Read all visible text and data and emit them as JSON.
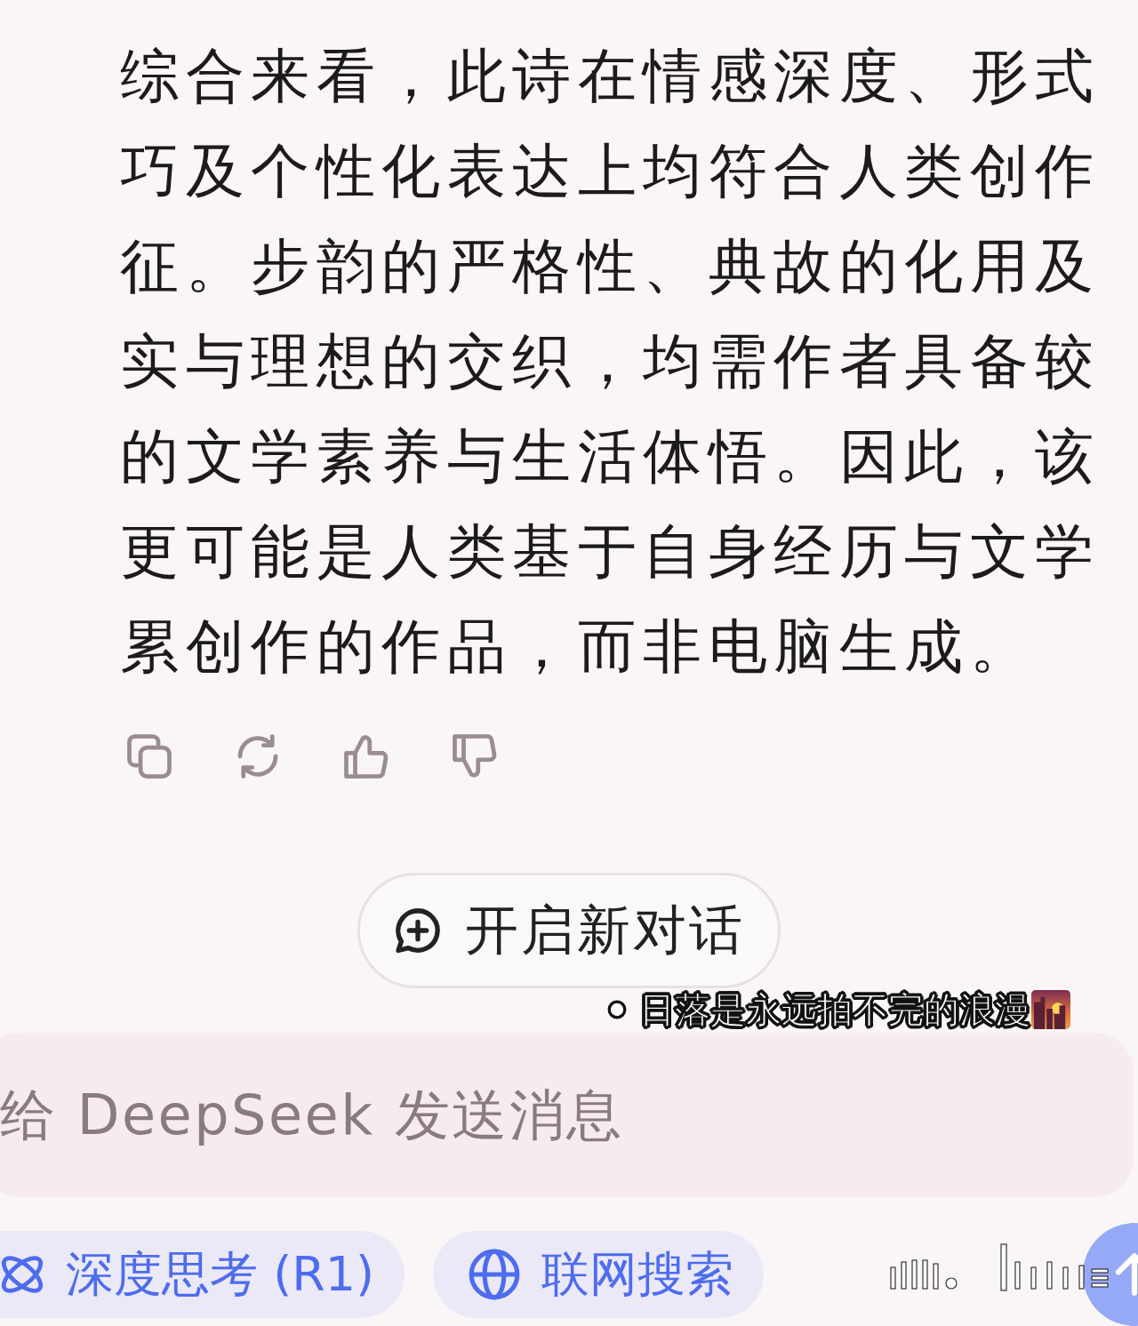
{
  "answer": {
    "lines": [
      "综合来看，此诗在情感深度、形式",
      "巧及个性化表达上均符合人类创作",
      "征。步韵的严格性、典故的化用及",
      "实与理想的交织，均需作者具备较",
      "的文学素养与生活体悟。因此，该",
      "更可能是人类基于自身经历与文学",
      "累创作的作品，而非电脑生成。"
    ]
  },
  "new_chat_button": {
    "label": "开启新对话"
  },
  "caption_sticker": {
    "text": "日落是永远拍不完的浪漫"
  },
  "composer": {
    "placeholder": "给 DeepSeek 发送消息"
  },
  "toggles": [
    {
      "kind": "deep_think",
      "label": "深度思考 (R1)",
      "on": true
    },
    {
      "kind": "web_search",
      "label": "联网搜索",
      "on": true
    }
  ],
  "send_button": {
    "disabled": true
  }
}
